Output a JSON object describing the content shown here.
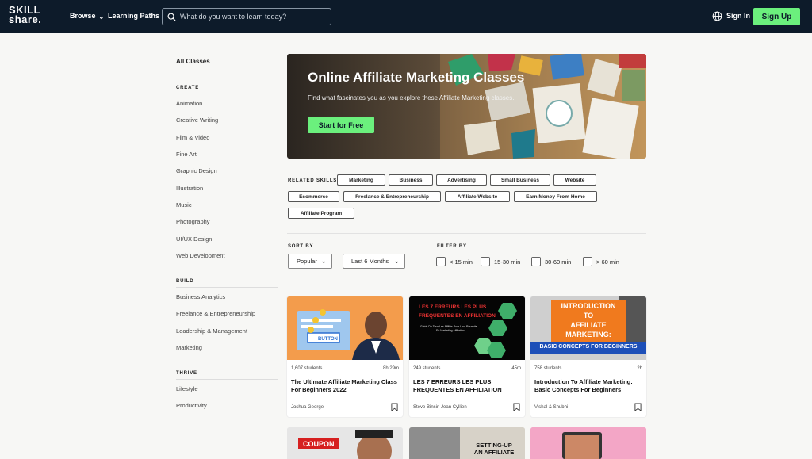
{
  "header": {
    "logo_line1": "SKILL",
    "logo_line2": "share.",
    "browse": "Browse",
    "learning_paths": "Learning Paths",
    "search_placeholder": "What do you want to learn today?",
    "sign_in": "Sign In",
    "sign_up": "Sign Up"
  },
  "sidebar": {
    "all": "All Classes",
    "sections": [
      {
        "heading": "CREATE",
        "items": [
          "Animation",
          "Creative Writing",
          "Film & Video",
          "Fine Art",
          "Graphic Design",
          "Illustration",
          "Music",
          "Photography",
          "UI/UX Design",
          "Web Development"
        ]
      },
      {
        "heading": "BUILD",
        "items": [
          "Business Analytics",
          "Freelance & Entrepreneurship",
          "Leadership & Management",
          "Marketing"
        ]
      },
      {
        "heading": "THRIVE",
        "items": [
          "Lifestyle",
          "Productivity"
        ]
      }
    ]
  },
  "hero": {
    "title": "Online Affiliate Marketing Classes",
    "subtitle": "Find what fascinates you as you explore these Affiliate Marketing classes.",
    "cta": "Start for Free"
  },
  "skills": {
    "label": "RELATED SKILLS",
    "chips": [
      "Marketing",
      "Business",
      "Advertising",
      "Small Business",
      "Website",
      "Ecommerce",
      "Freelance & Entrepreneurship",
      "Affiliate Website",
      "Earn Money From Home",
      "Affiliate Program"
    ]
  },
  "sort": {
    "label": "SORT BY",
    "popular": "Popular",
    "period": "Last 6 Months"
  },
  "filter": {
    "label": "FILTER BY",
    "options": [
      "< 15 min",
      "15-30 min",
      "30-60 min",
      "> 60 min"
    ]
  },
  "cards": [
    {
      "students": "1,607 students",
      "duration": "8h 29m",
      "title": "The Ultimate Affiliate Marketing Class For Beginners 2022",
      "author": "Joshua George",
      "thumb_text": "BUTTON"
    },
    {
      "students": "249 students",
      "duration": "45m",
      "title": "LES 7 ERREURS LES PLUS FREQUENTES EN AFFILIATION",
      "author": "Steve Binsin Jean Cyllien",
      "thumb_line1": "LES 7 ERREURS LES PLUS",
      "thumb_line2": "FREQUENTES EN AFFILIATION",
      "thumb_small1": "Guide De Tous Les Affiliés Pour Leur Réussite",
      "thumb_small2": "En Marketing Affiliation"
    },
    {
      "students": "758 students",
      "duration": "2h",
      "title": "Introduction To Affiliate Marketing: Basic Concepts For Beginners",
      "author": "Vishal & Shubhi",
      "thumb_line1": "INTRODUCTION",
      "thumb_line2": "TO",
      "thumb_line3": "AFFILIATE",
      "thumb_line4": "MARKETING:",
      "thumb_band": "BASIC CONCEPTS FOR BEGINNERS"
    }
  ],
  "bottom_cards": {
    "coupon": "COUPON",
    "setting_up_1": "SETTING-UP",
    "setting_up_2": "AN AFFILIATE"
  }
}
